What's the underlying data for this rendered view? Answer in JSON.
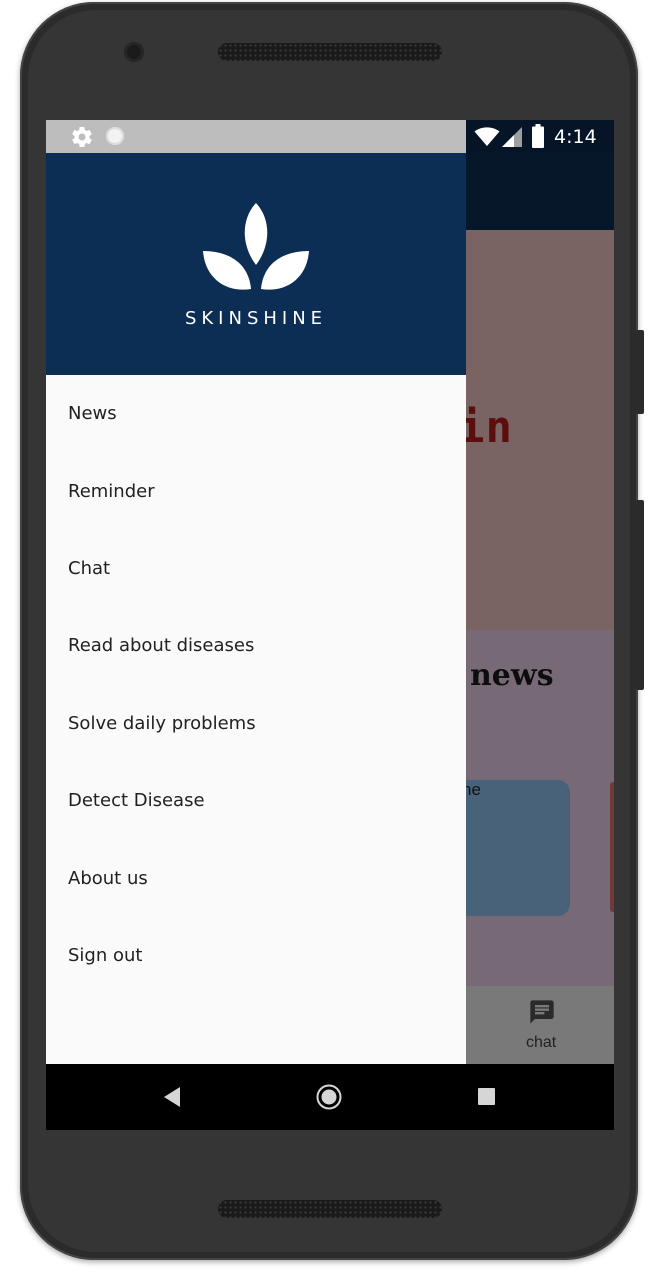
{
  "status_bar": {
    "time": "4:14",
    "icons": [
      "settings-icon",
      "circle-icon",
      "wifi-icon",
      "signal-icon",
      "battery-icon"
    ]
  },
  "drawer": {
    "brand": "SKINSHINE",
    "logo_icon": "leaf-logo",
    "header_color": "#0d2e54",
    "menu": [
      {
        "label": "News"
      },
      {
        "label": "Reminder"
      },
      {
        "label": "Chat"
      },
      {
        "label": "Read about diseases"
      },
      {
        "label": "Solve daily problems"
      },
      {
        "label": "Detect Disease"
      },
      {
        "label": "About us"
      },
      {
        "label": "Sign out"
      }
    ]
  },
  "background_app": {
    "hero_text_fragment": "in",
    "news_title_fragment": "news",
    "card_text_fragment": "ne",
    "bottom_nav": {
      "chat_label": "chat",
      "chat_icon": "chat-icon"
    }
  },
  "nav_bar": {
    "icons": [
      "back-icon",
      "home-icon",
      "recents-icon"
    ]
  }
}
